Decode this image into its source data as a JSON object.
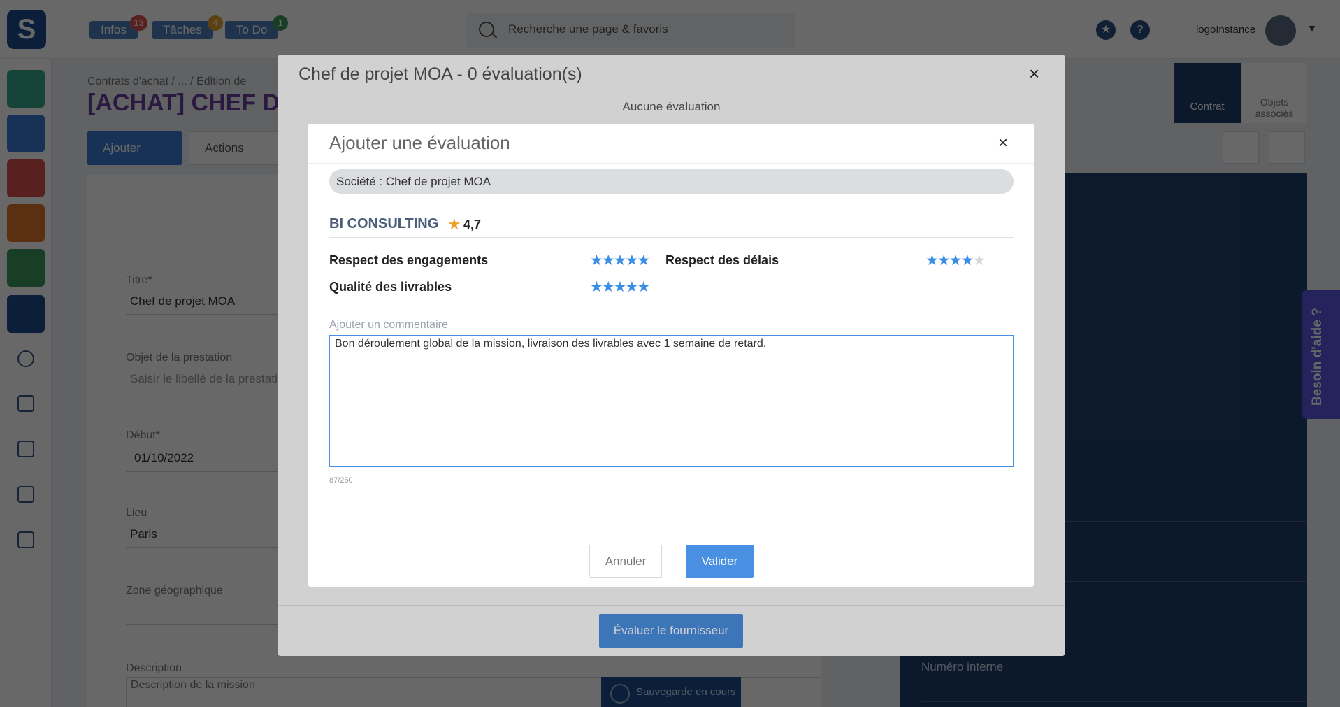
{
  "topbar": {
    "logo": "S",
    "buttons": [
      {
        "label": "Infos",
        "count": "13",
        "color": "#d9534f"
      },
      {
        "label": "Tâches",
        "count": "4",
        "color": "#e0a030"
      },
      {
        "label": "To Do",
        "count": "1",
        "color": "#3c9a5f"
      }
    ],
    "search_placeholder": "Recherche une page & favoris",
    "star_icon": "★",
    "help_icon": "?",
    "logo_instance": "logoInstance",
    "caret": "▼"
  },
  "breadcrumb": "Contrats d'achat  /  ...  /  Édition de",
  "page_title": "[ACHAT] CHEF D",
  "toolbar": {
    "add_label": "Ajouter",
    "actions_label": "Actions"
  },
  "form": {
    "titre_label": "Titre*",
    "titre_value": "Chef de projet MOA",
    "objet_label": "Objet de la prestation",
    "objet_placeholder": "Saisir le libellé de la prestatio",
    "debut_label": "Début*",
    "debut_value": "01/10/2022",
    "lieu_label": "Lieu",
    "lieu_value": "Paris",
    "zone_label": "Zone géographique",
    "description_label": "Description",
    "description_placeholder": "Description de la mission",
    "saving_label": "Sauvegarde en cours"
  },
  "right_panel": {
    "tab_contrat": "Contrat",
    "tab_objets": "Objets associés",
    "numero_interne_label": "Numéro interne"
  },
  "help_tab": "Besoin d'aide ?",
  "outer_dialog": {
    "title": "Chef de projet MOA - 0 évaluation(s)",
    "close": "×",
    "empty_text": "Aucune évaluation",
    "evaluate_button": "Évaluer le fournisseur"
  },
  "dialog": {
    "title": "Ajouter une évaluation",
    "close": "×",
    "societe": "Société : Chef de projet MOA",
    "supplier_name": "BI CONSULTING",
    "supplier_rating": "4,7",
    "criteria": [
      {
        "label": "Respect des engagements",
        "stars": 5,
        "max": 5
      },
      {
        "label": "Respect des délais",
        "stars": 4,
        "max": 5
      },
      {
        "label": "Qualité des livrables",
        "stars": 5,
        "max": 5
      }
    ],
    "comment_label": "Ajouter un commentaire",
    "comment_value": "Bon déroulement global de la mission, livraison des livrables avec 1 semaine de retard.",
    "counter": "87/250",
    "cancel_label": "Annuler",
    "submit_label": "Valider"
  }
}
